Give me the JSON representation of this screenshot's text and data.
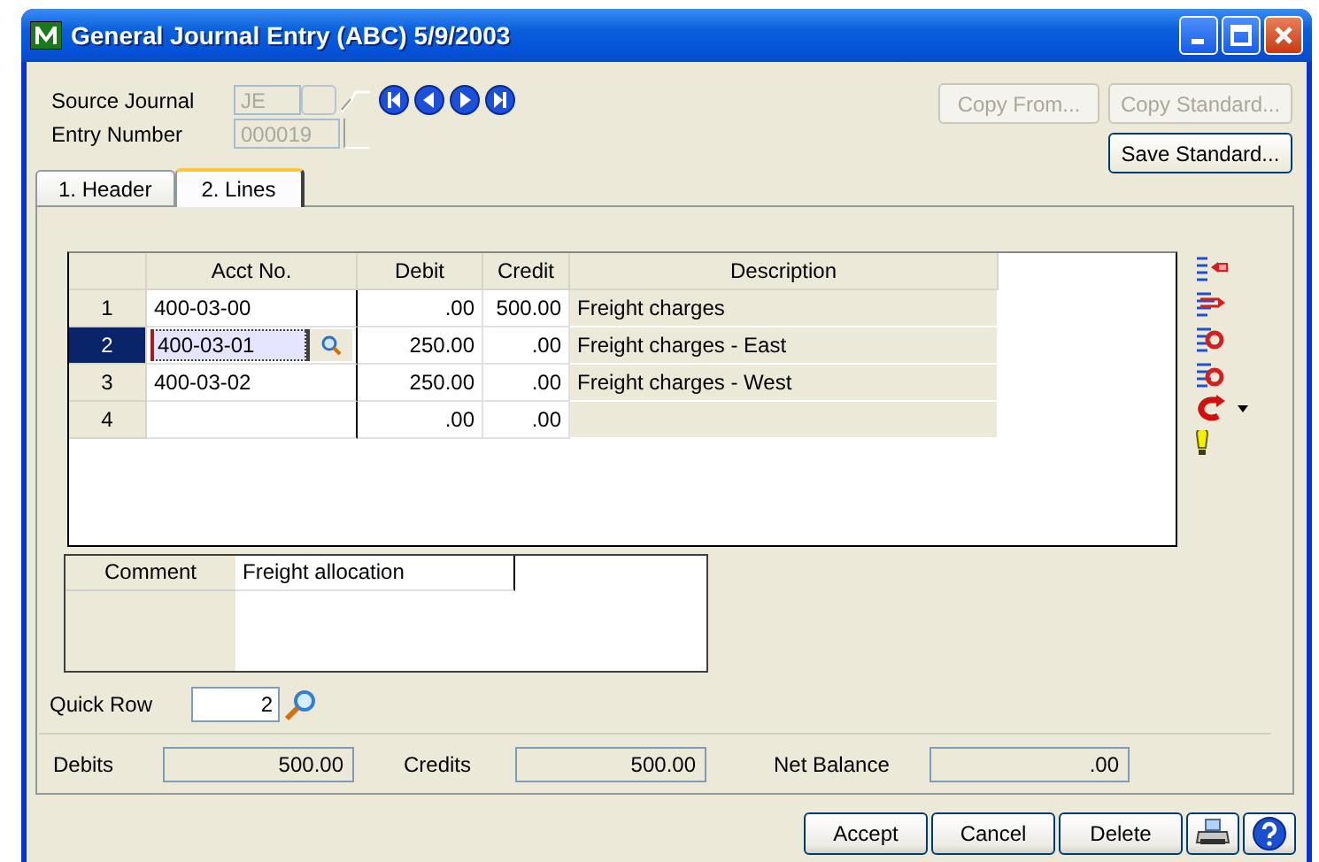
{
  "window": {
    "title": "General Journal Entry (ABC) 5/9/2003"
  },
  "header": {
    "source_journal": {
      "label": "Source Journal",
      "value": "JE",
      "disabled": true
    },
    "entry_number": {
      "label": "Entry Number",
      "value": "000019",
      "disabled": true
    }
  },
  "top_buttons": [
    {
      "label": "Copy From...",
      "disabled": true
    },
    {
      "label": "Copy Standard...",
      "disabled": true
    },
    {
      "label": "Save Standard...",
      "disabled": false
    }
  ],
  "tabs": [
    {
      "label": "1. Header",
      "selected": false
    },
    {
      "label": "2. Lines",
      "selected": true
    }
  ],
  "grid": {
    "columns": [
      "Acct No.",
      "Debit",
      "Credit",
      "Description"
    ],
    "rows": [
      {
        "number": "1",
        "acct": "400-03-00",
        "debit": ".00",
        "credit": "500.00",
        "description": "Freight charges",
        "selected": false
      },
      {
        "number": "2",
        "acct": "400-03-01",
        "debit": "250.00",
        "credit": ".00",
        "description": "Freight charges - East",
        "selected": true
      },
      {
        "number": "3",
        "acct": "400-03-02",
        "debit": "250.00",
        "credit": ".00",
        "description": "Freight charges - West",
        "selected": false
      },
      {
        "number": "4",
        "acct": "",
        "debit": ".00",
        "credit": ".00",
        "description": "",
        "selected": false
      }
    ]
  },
  "comment": {
    "label": "Comment",
    "value": "Freight allocation"
  },
  "quick_row": {
    "label": "Quick Row",
    "value": "2"
  },
  "totals": [
    {
      "label": "Debits",
      "value": "500.00"
    },
    {
      "label": "Credits",
      "value": "500.00"
    },
    {
      "label": "Net Balance",
      "value": ".00"
    }
  ],
  "bottom_buttons": [
    "Accept",
    "Cancel",
    "Delete"
  ]
}
